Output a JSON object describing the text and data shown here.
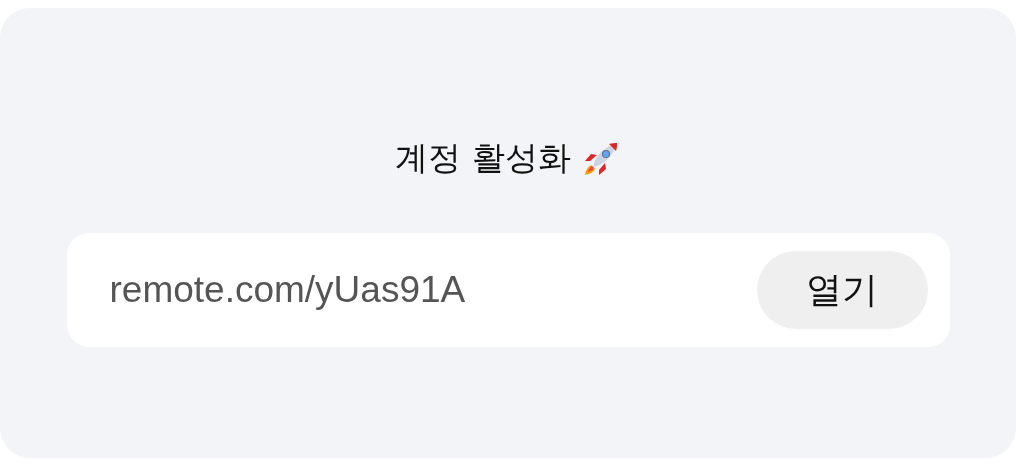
{
  "title": "계정 활성화",
  "link": {
    "url": "remote.com/yUas91A",
    "button": "열기"
  }
}
